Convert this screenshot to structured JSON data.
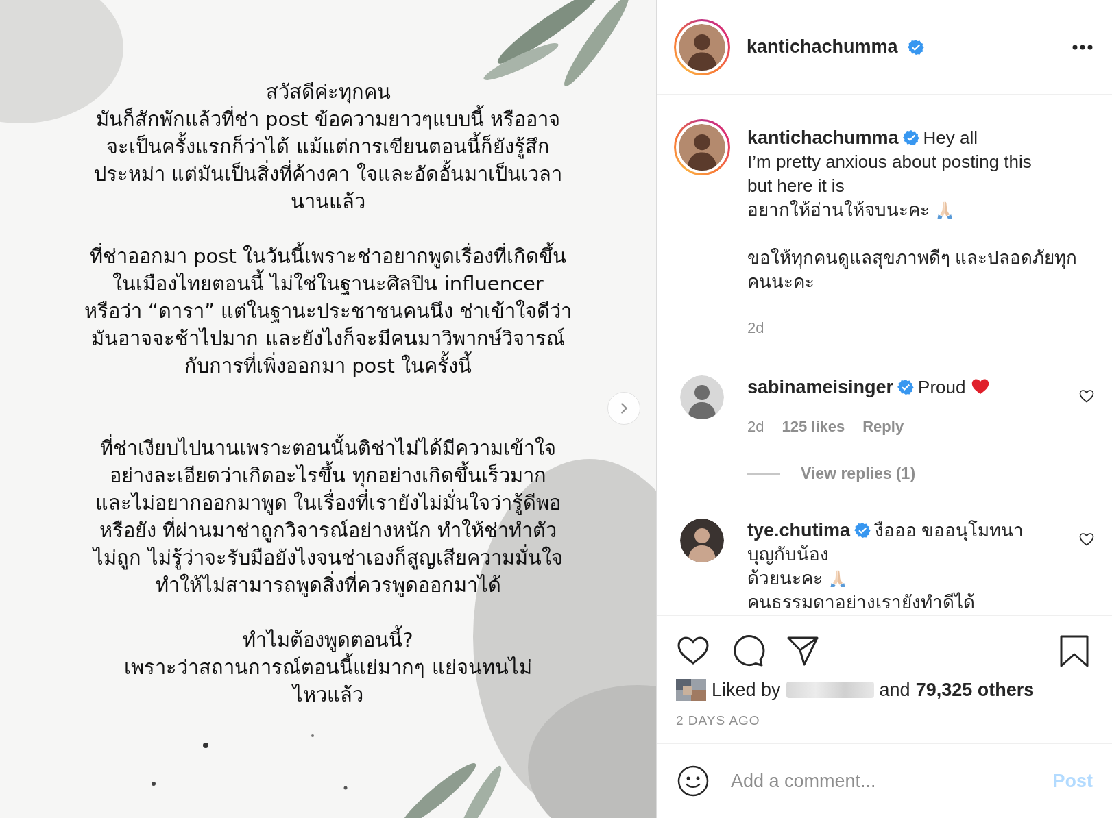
{
  "post_image": {
    "kind": "picture",
    "paragraphs": [
      "สวัสดีค่ะทุกคน\nมันก็สักพักแล้วที่ช่า post ข้อความยาวๆแบบนี้ หรืออาจ\nจะเป็นครั้งแรกก็ว่าได้ แม้แต่การเขียนตอนนี้ก็ยังรู้สึก\nประหม่า แต่มันเป็นสิ่งที่ค้างคา ใจและอัดอั้นมาเป็นเวลา\nนานแล้ว",
      "ที่ช่าออกมา post ในวันนี้เพราะช่าอยากพูดเรื่องที่เกิดขึ้น\nในเมืองไทยตอนนี้ ไม่ใช่ในฐานะศิลปิน influencer\nหรือว่า “ดารา” แต่ในฐานะประชาชนคนนึง ช่าเข้าใจดีว่า\nมันอาจจะช้าไปมาก และยังไงก็จะมีคนมาวิพากษ์วิจารณ์\nกับการที่เพิ่งออกมา post ในครั้งนี้",
      "ที่ช่าเงียบไปนานเพราะตอนนั้นติช่าไม่ได้มีความเข้าใจ\nอย่างละเอียดว่าเกิดอะไรขึ้น ทุกอย่างเกิดขึ้นเร็วมาก\nและไม่อยากออกมาพูด ในเรื่องที่เรายังไม่มั่นใจว่ารู้ดีพอ\nหรือยัง ที่ผ่านมาช่าถูกวิจารณ์อย่างหนัก ทำให้ช่าทำตัว\nไม่ถูก ไม่รู้ว่าจะรับมือยังไงจนช่าเองก็สูญเสียความมั่นใจ\nทำให้ไม่สามารถพูดสิ่งที่ควรพูดออกมาได้",
      "ทำไมต้องพูดตอนนี้?\nเพราะว่าสถานการณ์ตอนนี้แย่มากๆ แย่จนทนไม่\nไหวแล้ว"
    ]
  },
  "header": {
    "username": "kantichachumma",
    "verified": true
  },
  "caption": {
    "username": "kantichachumma",
    "verified": true,
    "lines": [
      {
        "kind": "plain",
        "text": "Hey all"
      },
      {
        "kind": "plain",
        "text": "I’m pretty anxious about posting this"
      },
      {
        "kind": "plain",
        "text": "but here it is"
      },
      {
        "kind": "praying_hands",
        "text": "อยากให้อ่านให้จบนะคะ"
      },
      {
        "kind": "plain",
        "text": "ขอให้ทุกคนดูแลสุขภาพดีๆ และปลอดภัยทุก",
        "gap_before": true
      },
      {
        "kind": "plain",
        "text": "คนนะคะ"
      }
    ],
    "time": "2d"
  },
  "comments": [
    {
      "username": "sabinameisinger",
      "verified": true,
      "liked": false,
      "lines": [
        {
          "kind": "red_heart",
          "text": "Proud"
        }
      ],
      "time": "2d",
      "likes": "125 likes",
      "reply": "Reply",
      "view_replies": "View replies (1)"
    },
    {
      "username": "tye.chutima",
      "verified": true,
      "liked": false,
      "lines": [
        {
          "kind": "plain",
          "text": "งือออ ขออนุโมทนา"
        },
        {
          "kind": "plain",
          "text": "บุญกับน้อง"
        },
        {
          "kind": "praying_hands",
          "text": "ด้วยนะคะ"
        },
        {
          "kind": "plain",
          "text": "คนธรรมดาอย่างเรายังทำดีได้"
        }
      ]
    }
  ],
  "liked_by": {
    "prefix": "Liked by",
    "conjunction": "and",
    "others": "79,325 others"
  },
  "date": "2 DAYS AGO",
  "comment_box": {
    "placeholder": "Add a comment...",
    "post_button": {
      "label": "Post",
      "disabled": true
    }
  }
}
